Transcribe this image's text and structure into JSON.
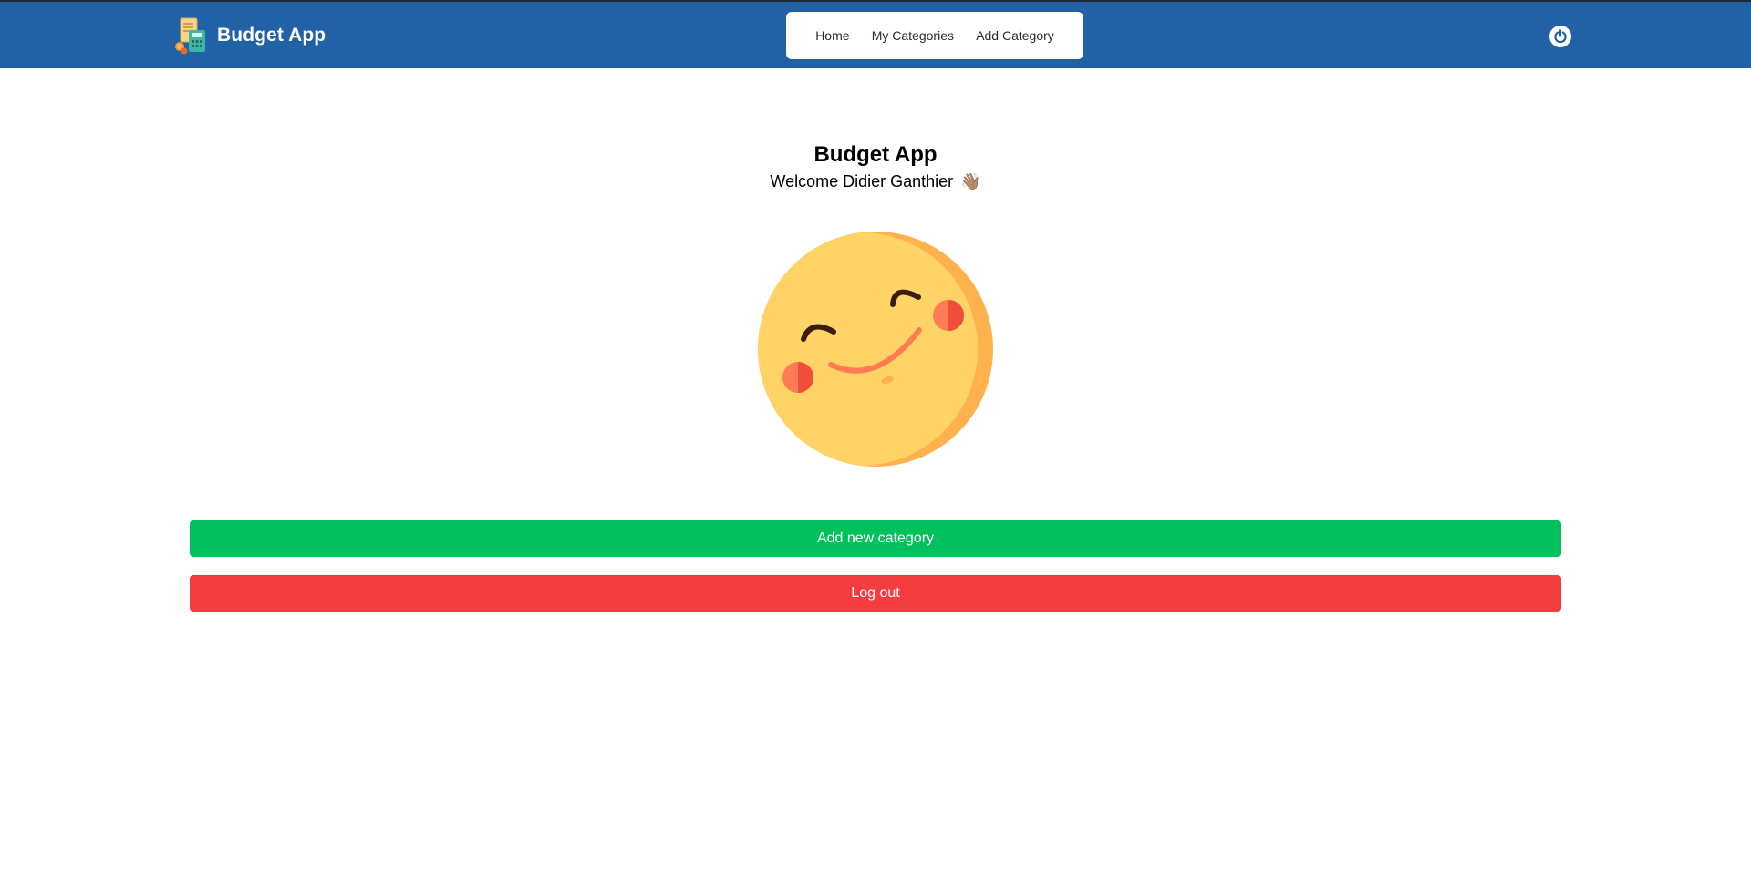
{
  "navbar": {
    "brand": {
      "name": "Budget App",
      "logo_icon": "budget-calculator-icon"
    },
    "links": [
      {
        "label": "Home"
      },
      {
        "label": "My Categories"
      },
      {
        "label": "Add Category"
      }
    ],
    "power_icon": "power-icon"
  },
  "hero": {
    "title": "Budget App",
    "welcome": "Welcome Didier Ganthier",
    "wave_emoji": "👋🏽",
    "illustration_icon": "smiling-face-icon"
  },
  "actions": {
    "add_category_label": "Add new category",
    "logout_label": "Log out"
  },
  "colors": {
    "navbar_bg": "#2161a5",
    "add_button": "#00c15b",
    "logout_button": "#f53c41"
  }
}
